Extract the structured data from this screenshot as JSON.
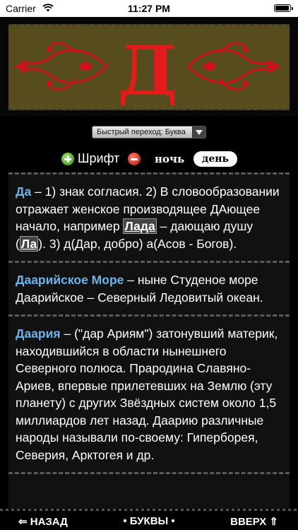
{
  "status": {
    "carrier": "Carrier",
    "time": "11:27 PM",
    "battery_level": 0.95
  },
  "header": {
    "letter": "Д",
    "letter_color": "#e31b1b",
    "banner_color": "#574c1d"
  },
  "controls": {
    "quick_jump": "Быстрый переход: Буква",
    "font_label": "Шрифт",
    "night_label": "ночь",
    "day_label": "день"
  },
  "entries": [
    {
      "term": "Да",
      "parts": [
        "– 1) знак согласия. 2) В словообразовании отражает женское производящее ДАющее начало, например ",
        "Лада",
        " – дающаю душу (",
        "Ла",
        "). 3) д(Дар, добро) а(Асов - Богов)."
      ]
    },
    {
      "term": "Даарийское Море",
      "text": "– ныне Студеное море Даарийское – Северный Ледовитый океан."
    },
    {
      "term": "Даария",
      "text": "– (\"дар Ариям\") затонувший материк, находившийся в области нынешнего Северного полюса. Прародина Славяно-Ариев, впервые прилетевших на Землю (эту планету) с других Звёздных систем около 1,5 миллиардов лет назад. Даарию различные народы называли по-своему: Гиперборея, Северия, Арктогея и др."
    }
  ],
  "bottom": {
    "back": "⇐ НАЗАД",
    "letters": "• БУКВЫ •",
    "up": "ВВЕРХ ⇑"
  }
}
